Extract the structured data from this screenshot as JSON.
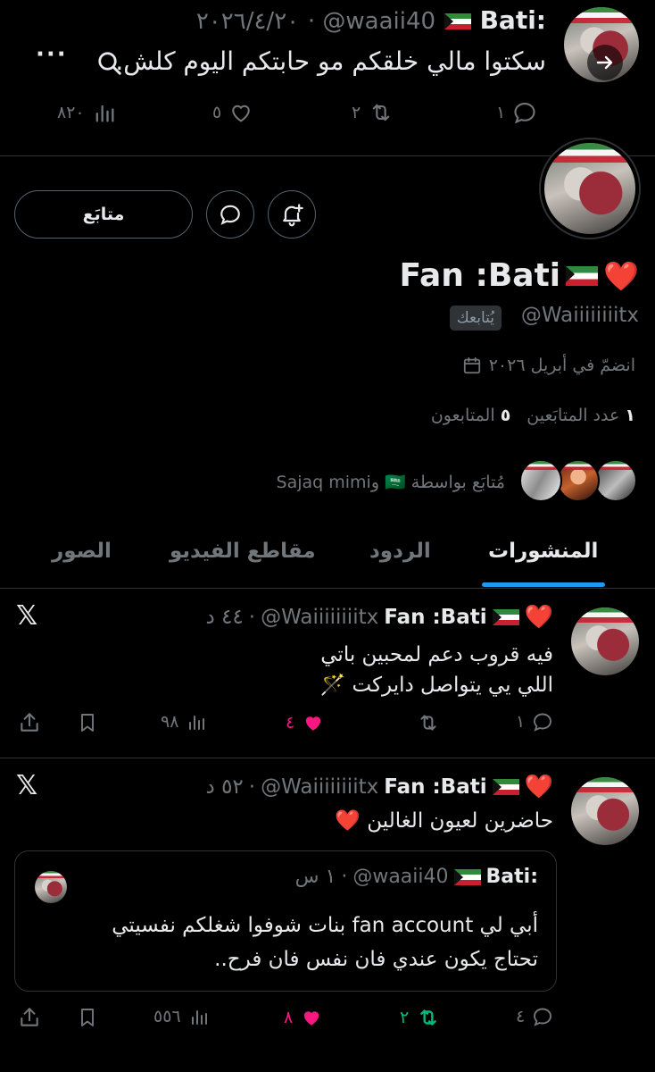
{
  "top_tweet": {
    "display_name": "Bati:",
    "handle": "@waaii40",
    "date": "٢٠٢٦/٤/٢٠",
    "text": "سكتوا مالي خلقكم مو حابتكم اليوم كلش.",
    "replies": "١",
    "reposts": "٢",
    "likes": "٥",
    "views": "٨٢٠"
  },
  "profile": {
    "follow_label": "متابَع",
    "name": "Fan :Bati",
    "name_emoji": "❤️",
    "handle": "@Waiiiiiiiitx",
    "follows_you": "يُتابعك",
    "joined": "انضمّ في أبريل ٢٠٢٦",
    "following_count": "١",
    "following_label": "عدد المتابَعين",
    "followers_count": "٥",
    "followers_label": "المتابعون",
    "followed_by": "مُتابَع بواسطة 🇸🇦 وSajaq mimi"
  },
  "tabs": [
    "المنشورات",
    "الردود",
    "مقاطع الفيديو",
    "الصور"
  ],
  "posts": [
    {
      "name": "Fan :Bati",
      "handle": "@Waiiiiiiiitx",
      "time": "٤٤ د",
      "lines": [
        "فيه قروب دعم لمحبين باتي",
        "اللي يي يتواصل دايركت 🪄"
      ],
      "replies": "١",
      "reposts": "",
      "likes": "٤",
      "views": "٩٨"
    },
    {
      "name": "Fan :Bati",
      "handle": "@Waiiiiiiiitx",
      "time": "٥٢ د",
      "lines": [
        "حاضرين لعيون الغالين ❤️"
      ],
      "quote": {
        "name": "Bati:",
        "handle": "@waaii40",
        "time": "١ س",
        "lines": [
          "أبي لي fan account بنات شوفوا شغلكم نفسيتي",
          "تحتاج يكون عندي فان نفس فان فرح.."
        ]
      },
      "replies": "٤",
      "reposts": "٢",
      "likes": "٨",
      "views": "٥٥٦"
    }
  ],
  "colors": {
    "background": "#000000",
    "text": "#e7e9ea",
    "muted": "#71767b",
    "divider": "#2f3336",
    "accent": "#1d9bf0",
    "like": "#f91880",
    "repost": "#00ba7c"
  },
  "icons": [
    "back-arrow-icon",
    "search-icon",
    "more-icon",
    "reply-icon",
    "repost-icon",
    "like-icon",
    "views-icon",
    "bookmark-icon",
    "share-icon",
    "message-icon",
    "notify-icon",
    "calendar-icon",
    "x-logo-icon"
  ]
}
